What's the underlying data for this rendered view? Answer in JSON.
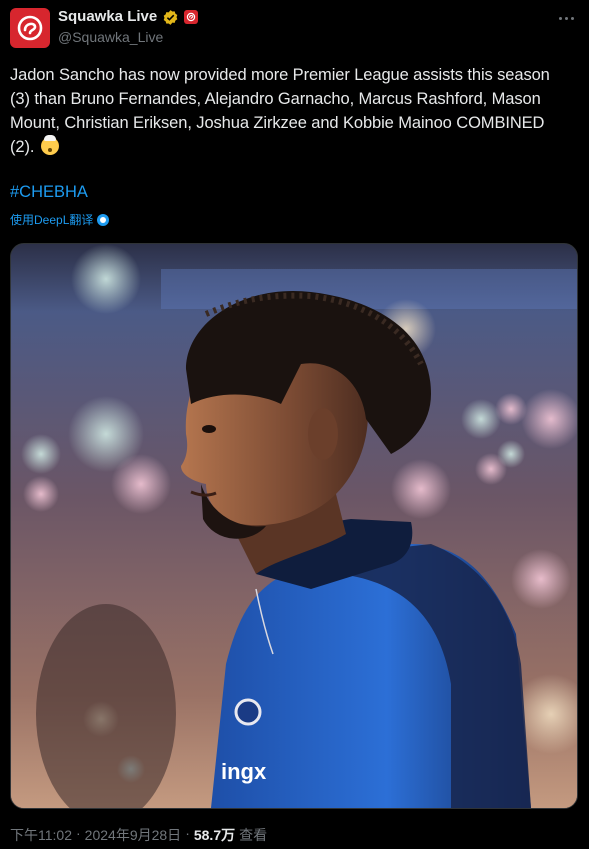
{
  "account": {
    "display_name": "Squawka Live",
    "handle": "@Squawka_Live",
    "avatar_icon": "squawka-logo-icon",
    "brand_color": "#d7262e",
    "verified_color": "#e2b719"
  },
  "tweet": {
    "text": "Jadon Sancho has now provided more Premier League assists this season (3) than Bruno Fernandes, Alejandro Garnacho, Marcus Rashford, Mason Mount, Christian Eriksen, Joshua Zirkzee and Kobbie Mainoo COMBINED (2).",
    "emoji": "exploding-head-emoji",
    "hashtag": "#CHEBHA",
    "translate_label": "使用DeepL翻译",
    "photo": {
      "shirt_text": "ingx"
    }
  },
  "meta": {
    "time": "下午11:02",
    "separator": "·",
    "date": "2024年9月28日",
    "views_count": "58.7万",
    "views_label": "查看"
  },
  "colors": {
    "link": "#1d9bf0",
    "muted": "#71767b",
    "text": "#e7e9ea",
    "background": "#000000"
  }
}
